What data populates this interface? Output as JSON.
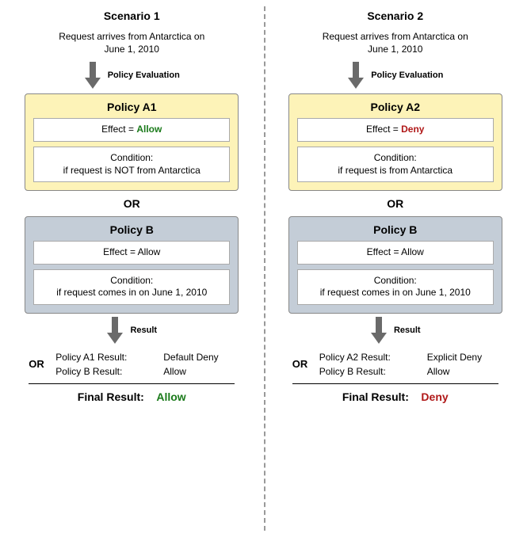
{
  "scenarios": [
    {
      "title": "Scenario 1",
      "request": "Request arrives from Antarctica on\nJune 1, 2010",
      "eval_label": "Policy Evaluation",
      "policyA": {
        "title": "Policy A1",
        "effect_label": "Effect = ",
        "effect_value": "Allow",
        "effect_class": "allow",
        "condition": "Condition:\nif request is NOT from Antarctica"
      },
      "or": "OR",
      "policyB": {
        "title": "Policy B",
        "effect_label": "Effect = Allow",
        "condition": "Condition:\nif request comes in on June 1, 2010"
      },
      "result_label": "Result",
      "results": {
        "or": "OR",
        "lineA_label": "Policy A1 Result:",
        "lineA_value": "Default Deny",
        "lineB_label": "Policy B Result:",
        "lineB_value": "Allow",
        "final_label": "Final Result:",
        "final_value": "Allow",
        "final_class": "allow"
      }
    },
    {
      "title": "Scenario 2",
      "request": "Request arrives from Antarctica on\nJune 1, 2010",
      "eval_label": "Policy Evaluation",
      "policyA": {
        "title": "Policy A2",
        "effect_label": "Effect = ",
        "effect_value": "Deny",
        "effect_class": "deny",
        "condition": "Condition:\nif request is from Antarctica"
      },
      "or": "OR",
      "policyB": {
        "title": "Policy B",
        "effect_label": "Effect = Allow",
        "condition": "Condition:\nif request comes in on June 1, 2010"
      },
      "result_label": "Result",
      "results": {
        "or": "OR",
        "lineA_label": "Policy A2 Result:",
        "lineA_value": "Explicit Deny",
        "lineB_label": "Policy B Result:",
        "lineB_value": "Allow",
        "final_label": "Final Result:",
        "final_value": "Deny",
        "final_class": "deny"
      }
    }
  ],
  "chart_data": {
    "type": "table",
    "title": "Policy evaluation OR-combination: Allow vs Deny precedence",
    "scenarios": [
      {
        "name": "Scenario 1",
        "request": {
          "origin": "Antarctica",
          "date": "2010-06-01"
        },
        "policies": [
          {
            "id": "A1",
            "effect": "Allow",
            "condition": "request is NOT from Antarctica",
            "result": "Default Deny"
          },
          {
            "id": "B",
            "effect": "Allow",
            "condition": "request comes in on June 1, 2010",
            "result": "Allow"
          }
        ],
        "combine": "OR",
        "final": "Allow"
      },
      {
        "name": "Scenario 2",
        "request": {
          "origin": "Antarctica",
          "date": "2010-06-01"
        },
        "policies": [
          {
            "id": "A2",
            "effect": "Deny",
            "condition": "request is from Antarctica",
            "result": "Explicit Deny"
          },
          {
            "id": "B",
            "effect": "Allow",
            "condition": "request comes in on June 1, 2010",
            "result": "Allow"
          }
        ],
        "combine": "OR",
        "final": "Deny"
      }
    ]
  }
}
